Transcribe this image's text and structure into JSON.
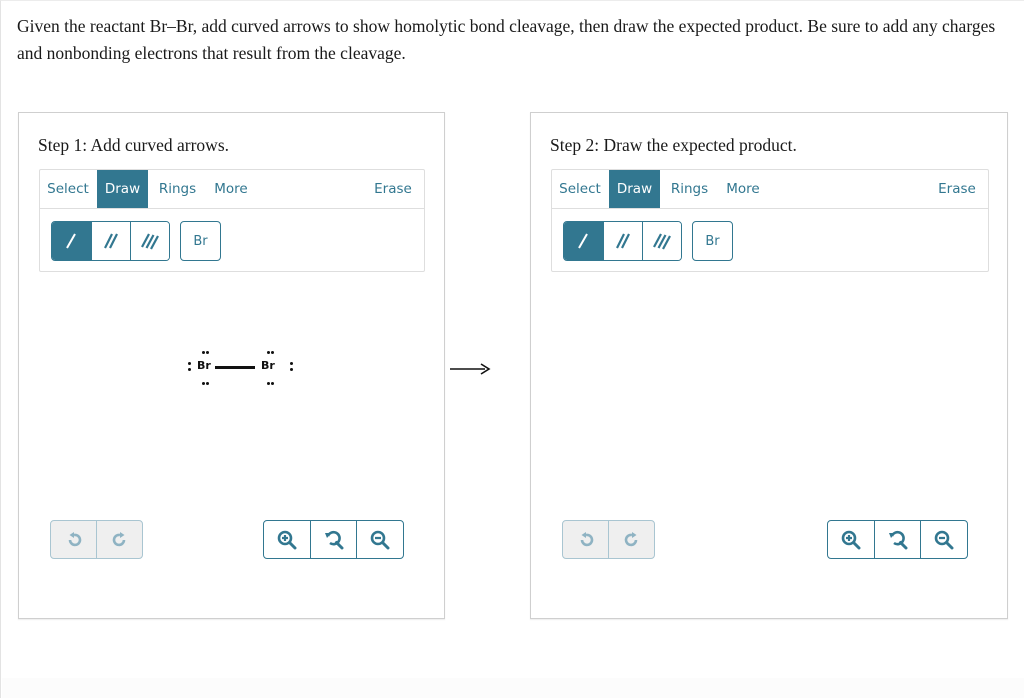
{
  "question": {
    "text": "Given the reactant Br–Br, add curved arrows to show homolytic bond cleavage, then draw the expected product. Be sure to add any charges and nonbonding electrons that result from the cleavage."
  },
  "colors": {
    "accent": "#327790",
    "disabled_border": "#a9c5d1",
    "disabled_bg": "#efefef",
    "panel_border": "#cfcfcf"
  },
  "panels": [
    {
      "title": "Step 1: Add curved arrows.",
      "tabs": {
        "select": "Select",
        "draw": "Draw",
        "rings": "Rings",
        "more": "More",
        "erase": "Erase"
      },
      "active_tab": "Draw",
      "bond_tools": [
        {
          "icon": "single-bond-icon",
          "active": true
        },
        {
          "icon": "double-bond-icon",
          "active": false
        },
        {
          "icon": "triple-bond-icon",
          "active": false
        }
      ],
      "atom_tool": "Br",
      "molecule": {
        "atoms": [
          {
            "symbol": "Br",
            "lone_pairs": 3
          },
          {
            "symbol": "Br",
            "lone_pairs": 3
          }
        ],
        "bond": "single"
      },
      "history": {
        "undo": "undo-icon",
        "redo": "redo-icon",
        "enabled": false
      },
      "zoom": {
        "in": "zoom-in-icon",
        "reset": "zoom-reset-icon",
        "out": "zoom-out-icon"
      }
    },
    {
      "title": "Step 2: Draw the expected product.",
      "tabs": {
        "select": "Select",
        "draw": "Draw",
        "rings": "Rings",
        "more": "More",
        "erase": "Erase"
      },
      "active_tab": "Draw",
      "bond_tools": [
        {
          "icon": "single-bond-icon",
          "active": true
        },
        {
          "icon": "double-bond-icon",
          "active": false
        },
        {
          "icon": "triple-bond-icon",
          "active": false
        }
      ],
      "atom_tool": "Br",
      "history": {
        "undo": "undo-icon",
        "redo": "redo-icon",
        "enabled": false
      },
      "zoom": {
        "in": "zoom-in-icon",
        "reset": "zoom-reset-icon",
        "out": "zoom-out-icon"
      }
    }
  ],
  "reaction_arrow": "right-arrow-icon"
}
